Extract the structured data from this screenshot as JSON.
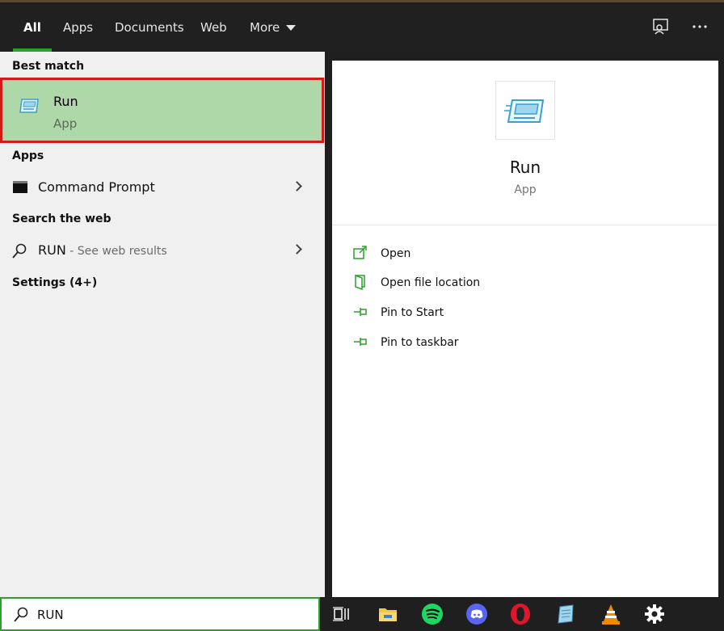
{
  "tabs": [
    {
      "label": "All",
      "active": true
    },
    {
      "label": "Apps"
    },
    {
      "label": "Documents"
    },
    {
      "label": "Web"
    },
    {
      "label": "More"
    }
  ],
  "sections": {
    "best_match": "Best match",
    "apps": "Apps",
    "search_web": "Search the web",
    "settings": "Settings (4+)"
  },
  "best_match": {
    "title": "Run",
    "subtitle": "App"
  },
  "apps_list": [
    {
      "label": "Command Prompt"
    }
  ],
  "web_result": {
    "query": "RUN",
    "hint": " - See web results"
  },
  "detail": {
    "name": "Run",
    "type": "App",
    "actions": [
      "Open",
      "Open file location",
      "Pin to Start",
      "Pin to taskbar"
    ]
  },
  "search": {
    "value": "RUN"
  },
  "colors": {
    "accent": "#2aa12a",
    "highlight": "#aed8a7",
    "outline": "#d11b1b"
  },
  "taskbar_icons": [
    "task-view-icon",
    "file-explorer-icon",
    "spotify-icon",
    "discord-icon",
    "opera-icon",
    "notepad-icon",
    "vlc-icon",
    "settings-gear-icon"
  ]
}
